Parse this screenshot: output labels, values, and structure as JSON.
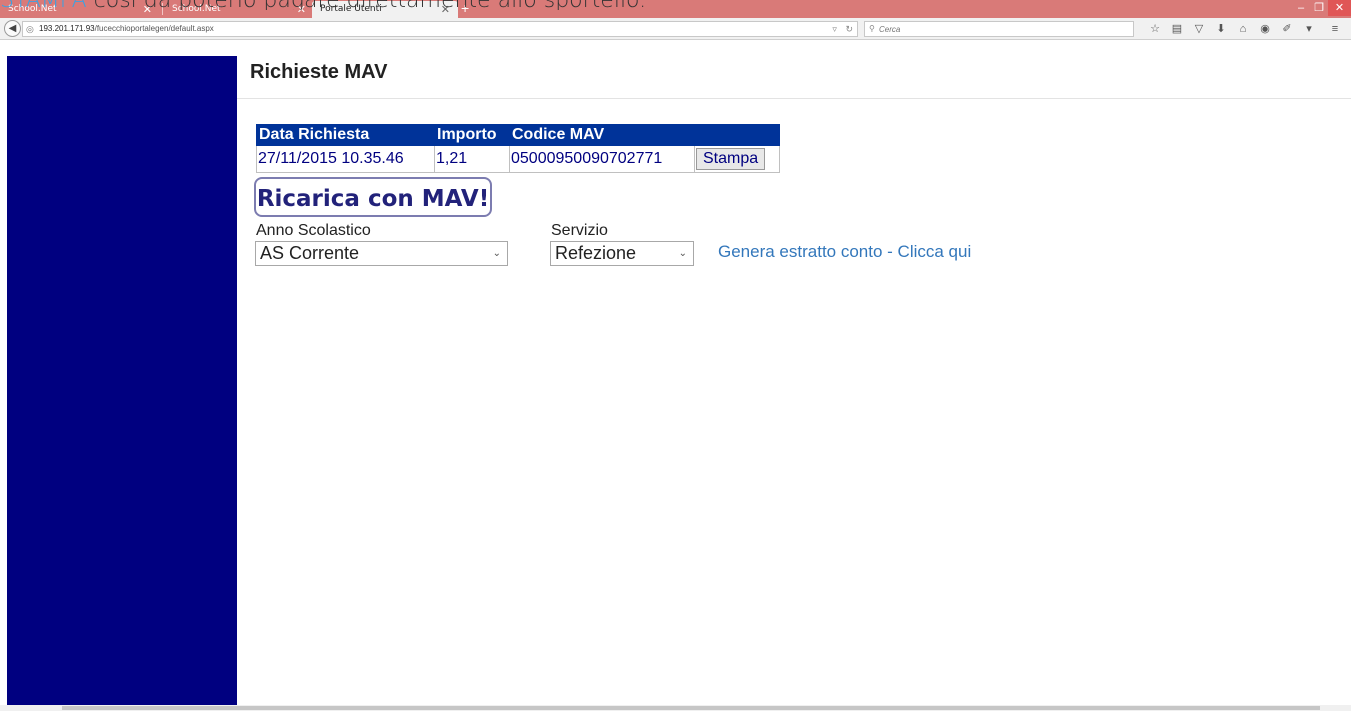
{
  "overlay": {
    "link_text": "STAMPA",
    "rest_text": " così da poterlo pagare direttamente allo sportello."
  },
  "browser": {
    "tabs": [
      {
        "label": "School.Net",
        "active": false
      },
      {
        "label": "School.Net",
        "active": false
      },
      {
        "label": "Portale Utenti",
        "active": true
      }
    ],
    "new_tab_label": "+",
    "url_host": "193.201.171.93",
    "url_path": "/fucecchioportalegen/default.aspx",
    "search_placeholder": "Cerca"
  },
  "page": {
    "title": "Richieste MAV",
    "table": {
      "headers": [
        "Data Richiesta",
        "Importo",
        "Codice MAV",
        ""
      ],
      "rows": [
        {
          "data": "27/11/2015 10.35.46",
          "importo": "1,21",
          "codice": "05000950090702771",
          "action": "Stampa"
        }
      ]
    },
    "recharge_label": "Ricarica con MAV!",
    "anno_label": "Anno Scolastico",
    "anno_value": "AS Corrente",
    "servizio_label": "Servizio",
    "servizio_value": "Refezione",
    "estratto_link": "Genera estratto conto - Clicca qui"
  },
  "colors": {
    "sidebar": "#000080",
    "table_header": "#003399",
    "tab_strip": "#d97a78",
    "link": "#3377bb"
  }
}
